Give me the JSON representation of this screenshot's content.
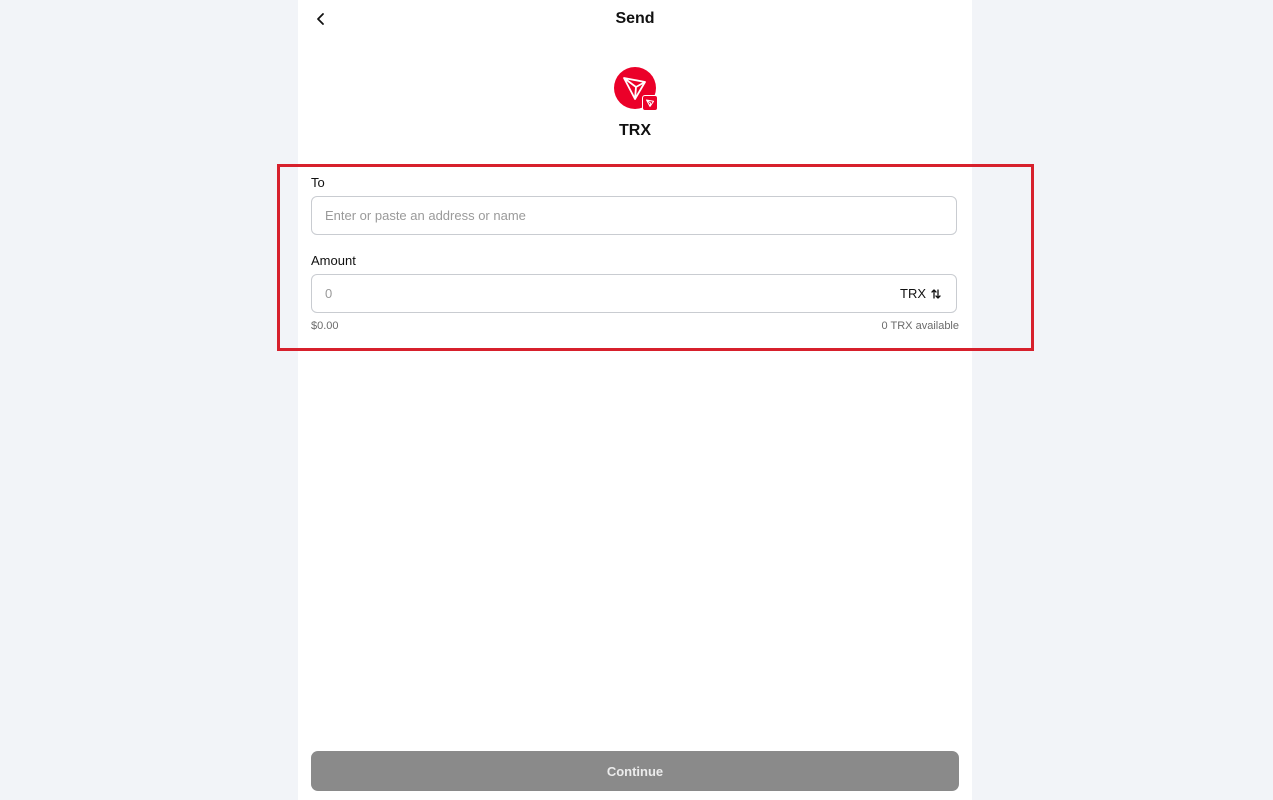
{
  "header": {
    "title": "Send"
  },
  "token": {
    "name": "TRX",
    "brand_color": "#eb0029",
    "icon": "tron-logo-icon"
  },
  "form": {
    "to": {
      "label": "To",
      "placeholder": "Enter or paste an address or name",
      "value": ""
    },
    "amount": {
      "label": "Amount",
      "placeholder": "0",
      "value": "",
      "currency": "TRX",
      "fiat_value": "$0.00",
      "available": "0 TRX available"
    }
  },
  "actions": {
    "continue_label": "Continue",
    "continue_enabled": false
  },
  "colors": {
    "highlight": "#d7202c",
    "button_disabled": "#8a8a8a"
  }
}
